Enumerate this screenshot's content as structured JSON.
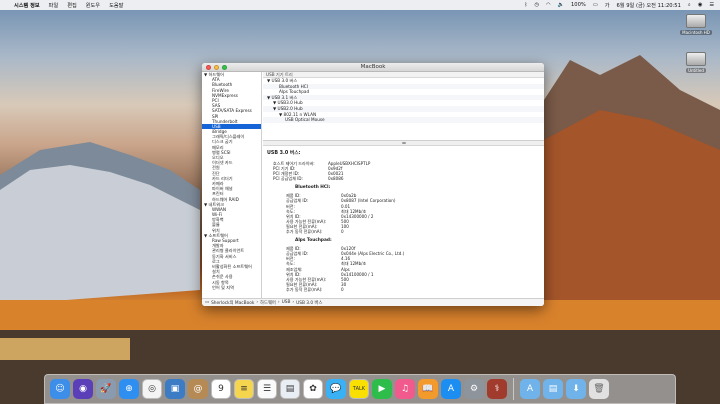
{
  "menubar": {
    "app_name": "시스템 정보",
    "items": [
      "파일",
      "편집",
      "윈도우",
      "도움말"
    ],
    "battery": "100%",
    "datetime": "6월 9일 (금) 오전 11:20:51"
  },
  "desktop_icons": [
    "Macintosh HD",
    "Untitled"
  ],
  "window": {
    "title": "MacBook",
    "sidebar": [
      {
        "label": "▼ 하드웨어",
        "cat": true
      },
      {
        "label": "ATA"
      },
      {
        "label": "Bluetooth"
      },
      {
        "label": "FireWire"
      },
      {
        "label": "NVMExpress"
      },
      {
        "label": "PCI"
      },
      {
        "label": "SAS"
      },
      {
        "label": "SATA/SATA Express"
      },
      {
        "label": "SPI"
      },
      {
        "label": "Thunderbolt"
      },
      {
        "label": "USB",
        "sel": true
      },
      {
        "label": "iBridge"
      },
      {
        "label": "그래픽/디스플레이"
      },
      {
        "label": "디스크 굽기"
      },
      {
        "label": "메모리"
      },
      {
        "label": "병렬 SCSI"
      },
      {
        "label": "오디오"
      },
      {
        "label": "이더넷 카드"
      },
      {
        "label": "전원"
      },
      {
        "label": "진단"
      },
      {
        "label": "카드 리더기"
      },
      {
        "label": "카메라"
      },
      {
        "label": "파이버 채널"
      },
      {
        "label": "프린터"
      },
      {
        "label": "하드웨어 RAID"
      },
      {
        "label": "▼ 네트워크",
        "cat": true
      },
      {
        "label": "WWAN"
      },
      {
        "label": "Wi-Fi"
      },
      {
        "label": "방화벽"
      },
      {
        "label": "볼륨"
      },
      {
        "label": "위치"
      },
      {
        "label": "▼ 소프트웨어",
        "cat": true
      },
      {
        "label": "Raw Support"
      },
      {
        "label": "개발자"
      },
      {
        "label": "관리형 클라이언트"
      },
      {
        "label": "동기화 서비스"
      },
      {
        "label": "로그"
      },
      {
        "label": "비활성화된 소프트웨어"
      },
      {
        "label": "설치"
      },
      {
        "label": "손쉬운 사용"
      },
      {
        "label": "시동 항목"
      },
      {
        "label": "언어 및 지역"
      }
    ],
    "tree_header": "USB 기기 트리",
    "tree": [
      {
        "label": "▼ USB 3.0 버스",
        "indent": 0
      },
      {
        "label": "Bluetooth HCI",
        "indent": 2
      },
      {
        "label": "Alps Touchpad",
        "indent": 2
      },
      {
        "label": "▼ USB 3.1 버스",
        "indent": 0
      },
      {
        "label": "▼ USB3.0 Hub",
        "indent": 1
      },
      {
        "label": "▼ USB2.0 Hub",
        "indent": 1
      },
      {
        "label": "▼ 802.11 n WLAN",
        "indent": 2
      },
      {
        "label": "USB Optical Mouse",
        "indent": 3
      }
    ],
    "detail_title": "USB 3.0 버스:",
    "bus_info": [
      {
        "k": "호스트 제어기 드라이버:",
        "v": "AppleUSBXHCISPTLP"
      },
      {
        "k": "PCI 기기 ID:",
        "v": "0x9d2f"
      },
      {
        "k": "PCI 개정판 ID:",
        "v": "0x0021"
      },
      {
        "k": "PCI 공급업체 ID:",
        "v": "0x8086"
      }
    ],
    "devices": [
      {
        "name": "Bluetooth HCI:",
        "props": [
          {
            "k": "제품 ID:",
            "v": "0x0a2b"
          },
          {
            "k": "공급업체 ID:",
            "v": "0x8087  (Intel Corporation)"
          },
          {
            "k": "버전:",
            "v": "0.01"
          },
          {
            "k": "속도:",
            "v": "최대 12Mb/초"
          },
          {
            "k": "위치 ID:",
            "v": "0x14300000 / 2"
          },
          {
            "k": "사용 가능한 전류(mA):",
            "v": "500"
          },
          {
            "k": "필요한 전류(mA):",
            "v": "100"
          },
          {
            "k": "추가 동작 전류(mA):",
            "v": "0"
          }
        ]
      },
      {
        "name": "Alps Touchpad:",
        "props": [
          {
            "k": "제품 ID:",
            "v": "0x120f"
          },
          {
            "k": "공급업체 ID:",
            "v": "0x044e  (Alps Electric Co., Ltd.)"
          },
          {
            "k": "버전:",
            "v": "4.16"
          },
          {
            "k": "속도:",
            "v": "최대 12Mb/초"
          },
          {
            "k": "제조업체:",
            "v": "Alps"
          },
          {
            "k": "위치 ID:",
            "v": "0x14100000 / 1"
          },
          {
            "k": "사용 가능한 전류(mA):",
            "v": "500"
          },
          {
            "k": "필요한 전류(mA):",
            "v": "30"
          },
          {
            "k": "추가 동작 전류(mA):",
            "v": "0"
          }
        ]
      }
    ],
    "pathbar": [
      "Sherlock의 MacBook",
      "하드웨어",
      "USB",
      "USB 3.0 버스"
    ]
  },
  "dock": {
    "apps": [
      {
        "name": "finder-icon",
        "bg": "#3d8ee8",
        "glyph": "☺"
      },
      {
        "name": "siri-icon",
        "bg": "#5b3fb8",
        "glyph": "◉"
      },
      {
        "name": "launchpad-icon",
        "bg": "#8a9bb0",
        "glyph": "🚀"
      },
      {
        "name": "safari-icon",
        "bg": "#2f8ff0",
        "glyph": "⊕"
      },
      {
        "name": "chrome-icon",
        "bg": "#f4f4f4",
        "glyph": "◎"
      },
      {
        "name": "photo-viewer-icon",
        "bg": "#3c7cc4",
        "glyph": "▣"
      },
      {
        "name": "contacts-icon",
        "bg": "#b58a55",
        "glyph": "@"
      },
      {
        "name": "calendar-icon",
        "bg": "#ffffff",
        "glyph": "9"
      },
      {
        "name": "notes-icon",
        "bg": "#f6d54e",
        "glyph": "≡"
      },
      {
        "name": "reminders-icon",
        "bg": "#fafafa",
        "glyph": "☰"
      },
      {
        "name": "preview-icon",
        "bg": "#e9eef4",
        "glyph": "▤"
      },
      {
        "name": "photos-icon",
        "bg": "#ffffff",
        "glyph": "✿"
      },
      {
        "name": "messages-icon",
        "bg": "#3ab0f5",
        "glyph": "💬"
      },
      {
        "name": "kakaotalk-icon",
        "bg": "#f9e000",
        "glyph": "TALK"
      },
      {
        "name": "facetime-icon",
        "bg": "#2ebd4a",
        "glyph": "▶"
      },
      {
        "name": "itunes-icon",
        "bg": "#f05a8c",
        "glyph": "♫"
      },
      {
        "name": "ibooks-icon",
        "bg": "#f39a2c",
        "glyph": "📖"
      },
      {
        "name": "app-store-icon",
        "bg": "#1c8ef2",
        "glyph": "A"
      },
      {
        "name": "system-preferences-icon",
        "bg": "#8e949c",
        "glyph": "⚙"
      },
      {
        "name": "system-information-icon",
        "bg": "#a13b2e",
        "glyph": "⚕"
      }
    ],
    "folders": [
      {
        "name": "applications-folder-icon",
        "glyph": "A"
      },
      {
        "name": "documents-folder-icon",
        "glyph": "▤"
      },
      {
        "name": "downloads-folder-icon",
        "glyph": "⬇"
      },
      {
        "name": "trash-icon",
        "glyph": "🗑"
      }
    ]
  }
}
